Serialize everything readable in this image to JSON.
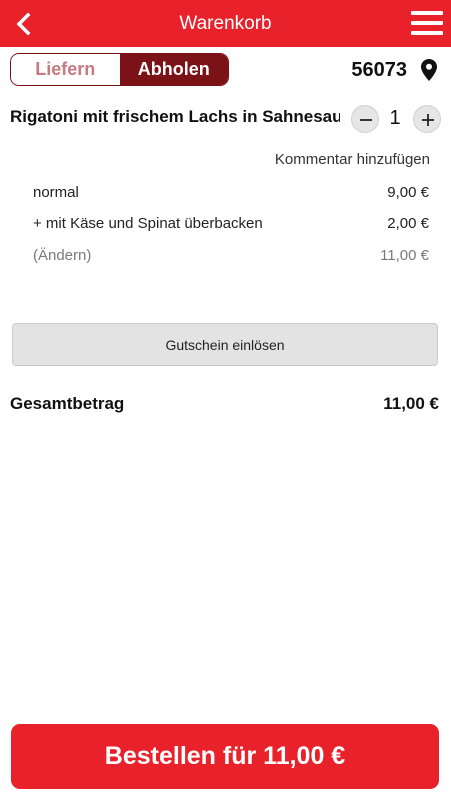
{
  "header": {
    "title": "Warenkorb",
    "back_icon": "chevron-left-icon",
    "menu_icon": "hamburger-menu-icon",
    "background_color": "#e8212b"
  },
  "mode": {
    "options": [
      "Liefern",
      "Abholen"
    ],
    "selected": "Abholen",
    "active_color": "#7a1218"
  },
  "location": {
    "zip": "56073",
    "icon": "map-pin-icon"
  },
  "cart_item": {
    "name": "Rigatoni mit frischem Lachs in Sahnesauce",
    "quantity": "1",
    "comment_link": "Kommentar hinzufügen",
    "lines": [
      {
        "label": "normal",
        "price": "9,00 €"
      },
      {
        "label": "+ mit Käse und Spinat überbacken",
        "price": "2,00 €"
      },
      {
        "label": "(Ändern)",
        "price": "11,00 €"
      }
    ]
  },
  "coupon": {
    "label": "Gutschein einlösen"
  },
  "total": {
    "label": "Gesamtbetrag",
    "value": "11,00 €"
  },
  "order_button": {
    "label": "Bestellen für 11,00 €",
    "color": "#e8212b"
  }
}
